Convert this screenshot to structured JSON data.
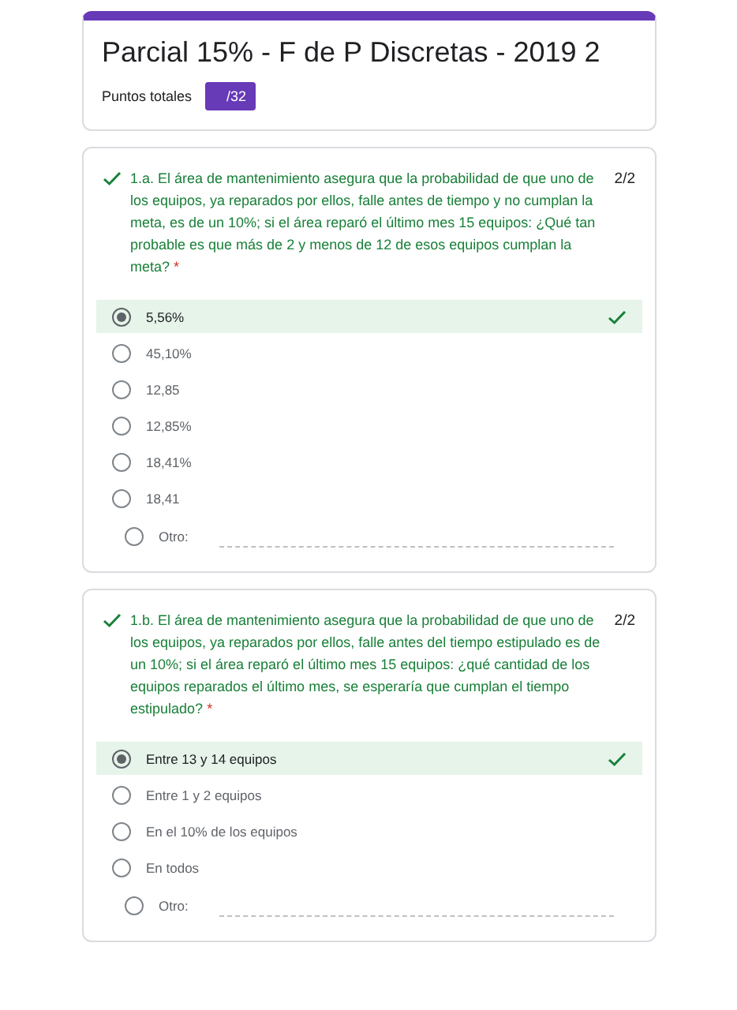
{
  "header": {
    "title": "Parcial 15% - F de P Discretas - 2019 2",
    "points_label": "Puntos totales",
    "points_badge": "/32"
  },
  "questions": [
    {
      "correct": true,
      "text": "1.a. El área de mantenimiento asegura que la probabilidad de que uno de los equipos, ya reparados por ellos, falle antes de tiempo y no cumplan la meta, es de un 10%; si el área reparó el último mes 15 equipos: ¿Qué tan probable es que más de 2 y menos de 12 de esos equipos cumplan la meta?",
      "required": "*",
      "score": "2/2",
      "options": [
        {
          "label": "5,56%",
          "selected": true
        },
        {
          "label": "45,10%",
          "selected": false
        },
        {
          "label": "12,85",
          "selected": false
        },
        {
          "label": "12,85%",
          "selected": false
        },
        {
          "label": "18,41%",
          "selected": false
        },
        {
          "label": "18,41",
          "selected": false
        }
      ],
      "other": {
        "label": "Otro:",
        "selected": false
      }
    },
    {
      "correct": true,
      "text": "1.b. El área de mantenimiento asegura que la probabilidad de que uno de los equipos, ya reparados por ellos, falle antes del tiempo estipulado es de un 10%; si el área reparó el último mes 15 equipos: ¿qué cantidad de los equipos reparados el último mes, se esperaría que cumplan el tiempo estipulado?",
      "required": "*",
      "score": "2/2",
      "options": [
        {
          "label": "Entre 13 y 14 equipos",
          "selected": true
        },
        {
          "label": "Entre 1 y 2 equipos",
          "selected": false
        },
        {
          "label": "En el 10% de los equipos",
          "selected": false
        },
        {
          "label": "En todos",
          "selected": false
        }
      ],
      "other": {
        "label": "Otro:",
        "selected": false
      }
    }
  ]
}
